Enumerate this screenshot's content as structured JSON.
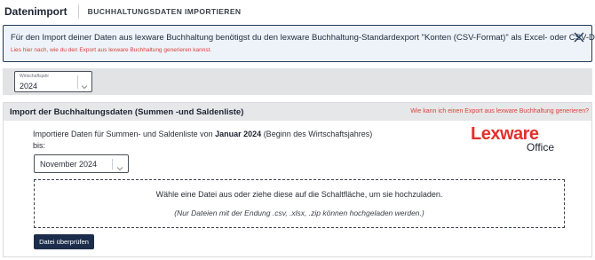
{
  "header": {
    "title": "Datenimport",
    "subtitle": "BUCHHALTUNGSDATEN IMPORTIEREN"
  },
  "info_banner": {
    "message": "Für den Import deiner Daten aus lexware Buchhaltung benötigst du den lexware Buchhaltung-Standardexport \"Konten (CSV-Format)\" als Excel- oder CSV-Datei.",
    "link": "Lies hier nach, wie du den Export aus lexware Buchhaltung generieren kannst."
  },
  "fiscal_year": {
    "label": "Wirtschaftsjahr",
    "value": "2024"
  },
  "panel": {
    "title": "Import der Buchhaltungsdaten (Summen -und Saldenliste)",
    "help_link": "Wie kann ich einen Export aus lexware Buchhaltung generieren?",
    "intro_prefix": "Importiere Daten für Summen- und Saldenliste von",
    "intro_bold": "Januar 2024",
    "intro_suffix": "(Beginn des Wirtschaftsjahres)",
    "intro_bis": "bis:",
    "month_value": "November 2024",
    "drop_text": "Wähle eine Datei aus oder ziehe diese auf die Schaltfläche, um sie hochzuladen.",
    "drop_hint": "(Nur Dateien mit der Endung .csv, .xlsx, .zip können hochgeladen werden.)",
    "button_label": "Datei überprüfen"
  },
  "logo": {
    "brand": "Lexware",
    "product": "Office"
  },
  "colors": {
    "accent_red": "#d8433a",
    "navy": "#1b2d4b"
  }
}
